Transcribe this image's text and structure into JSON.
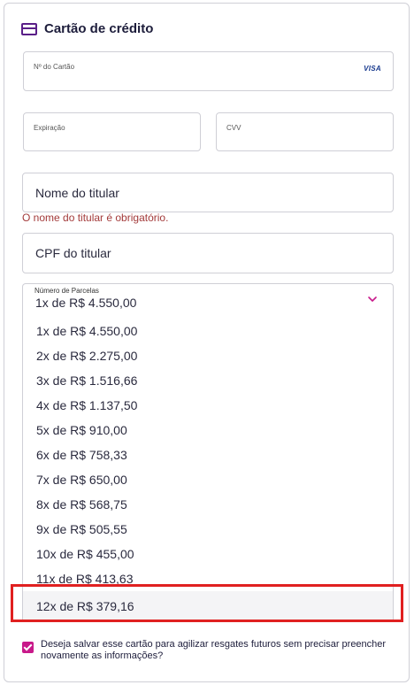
{
  "header": {
    "title": "Cartão de crédito",
    "icon": "credit-card-icon"
  },
  "card_number": {
    "label": "Nº do Cartão",
    "brand": "VISA"
  },
  "expiration": {
    "label": "Expiração"
  },
  "cvv": {
    "label": "CVV"
  },
  "holder_name": {
    "placeholder": "Nome do titular",
    "error": "O nome do titular é obrigatório."
  },
  "holder_cpf": {
    "placeholder": "CPF do titular"
  },
  "installments": {
    "label": "Número de Parcelas",
    "selected": "1x de R$ 4.550,00",
    "options": [
      "1x de R$ 4.550,00",
      "2x de R$ 2.275,00",
      "3x de R$ 1.516,66",
      "4x de R$ 1.137,50",
      "5x de R$ 910,00",
      "6x de R$ 758,33",
      "7x de R$ 650,00",
      "8x de R$ 568,75",
      "9x de R$ 505,55",
      "10x de R$ 455,00",
      "11x de R$ 413,63",
      "12x de R$ 379,16"
    ]
  },
  "save_card": {
    "checked": true,
    "text": "Deseja salvar esse cartão para agilizar resgates futuros sem precisar preencher novamente as informações?"
  },
  "colors": {
    "accent": "#c8198a",
    "brand": "#5a1f88",
    "error": "#a33a3a",
    "highlight": "#e02020"
  }
}
